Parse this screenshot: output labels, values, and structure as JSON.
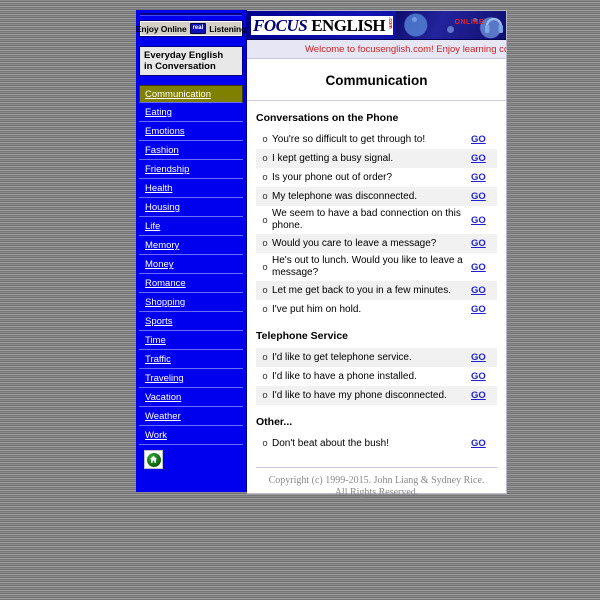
{
  "sidebar": {
    "listen_button": {
      "prefix": "Enjoy Online",
      "badge": "real",
      "suffix": "Listening"
    },
    "title_line1": "Everyday English",
    "title_line2": "in Conversation",
    "home_icon_name": "home-icon",
    "items": [
      {
        "label": "Communication",
        "active": true
      },
      {
        "label": "Eating",
        "active": false
      },
      {
        "label": "Emotions",
        "active": false
      },
      {
        "label": "Fashion",
        "active": false
      },
      {
        "label": "Friendship",
        "active": false
      },
      {
        "label": "Health",
        "active": false
      },
      {
        "label": "Housing",
        "active": false
      },
      {
        "label": "Life",
        "active": false
      },
      {
        "label": "Memory",
        "active": false
      },
      {
        "label": "Money",
        "active": false
      },
      {
        "label": "Romance",
        "active": false
      },
      {
        "label": "Shopping",
        "active": false
      },
      {
        "label": "Sports",
        "active": false
      },
      {
        "label": "Time",
        "active": false
      },
      {
        "label": "Traffic",
        "active": false
      },
      {
        "label": "Traveling",
        "active": false
      },
      {
        "label": "Vacation",
        "active": false
      },
      {
        "label": "Weather",
        "active": false
      },
      {
        "label": "Work",
        "active": false
      }
    ]
  },
  "banner": {
    "logo_focus": "FOCUS",
    "logo_english": "ENGLISH",
    "logo_com": ".com",
    "online_label": "ONLINE"
  },
  "welcome": {
    "text": "Welcome to focusenglish.com! Enjoy learning conversational"
  },
  "main": {
    "title": "Communication",
    "go_label": "GO",
    "bullet": "o",
    "sections": [
      {
        "heading": "Conversations on the Phone",
        "phrases": [
          "You're so difficult to get through to!",
          "I kept getting a busy signal.",
          "Is your phone out of order?",
          "My telephone was disconnected.",
          "We seem to have a bad connection on this phone.",
          "Would you care to leave a message?",
          "He's out to lunch.  Would you like to leave a message?",
          "Let me get back to you in a few minutes.",
          "I've put him on hold."
        ]
      },
      {
        "heading": "Telephone Service",
        "phrases": [
          "I'd like to get telephone service.",
          "I'd like to have a phone installed.",
          "I'd like to have my phone disconnected."
        ]
      },
      {
        "heading": "Other...",
        "phrases": [
          "Don't beat about the bush!"
        ]
      }
    ]
  },
  "footer": {
    "line1": "Copyright (c) 1999-2015.  John Liang & Sydney Rice.",
    "line2": "All Rights Reserved."
  }
}
